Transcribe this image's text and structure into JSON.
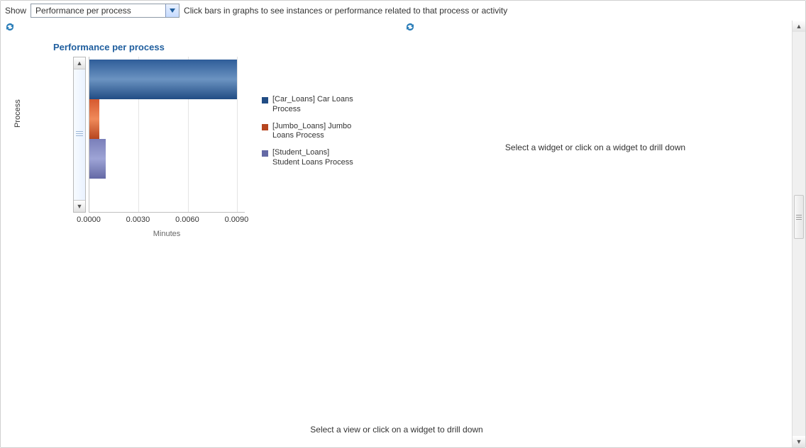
{
  "header": {
    "show_label": "Show",
    "selected_view": "Performance per process",
    "hint": "Click bars in graphs to see instances or performance related to that process or activity"
  },
  "placeholders": {
    "right_panel": "Select a widget or click on a widget to drill down",
    "bottom_panel": "Select a view or click on a widget to drill down"
  },
  "chart": {
    "title": "Performance per process",
    "y_axis_label": "Process",
    "x_axis_label": "Minutes"
  },
  "chart_data": {
    "type": "bar",
    "orientation": "horizontal",
    "xlabel": "Minutes",
    "ylabel": "Process",
    "xlim": [
      0,
      0.0095
    ],
    "x_ticks": [
      "0.0000",
      "0.0030",
      "0.0060",
      "0.0090"
    ],
    "series": [
      {
        "name": "[Car_Loans] Car Loans Process",
        "value": 0.009,
        "color_top": "#2f5d99",
        "color_mid": "#6b93c1",
        "color_bot": "#214c84"
      },
      {
        "name": "[Jumbo_Loans] Jumbo Loans Process",
        "value": 0.0006,
        "color_top": "#d65a2f",
        "color_mid": "#f08a5a",
        "color_bot": "#b6451f"
      },
      {
        "name": "[Student_Loans] Student Loans Process",
        "value": 0.001,
        "color_top": "#7a7fb9",
        "color_mid": "#9ea4d6",
        "color_bot": "#6469a5"
      }
    ]
  }
}
